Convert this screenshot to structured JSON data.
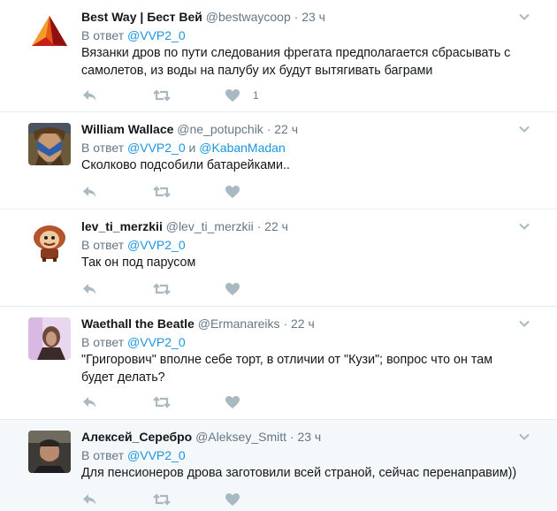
{
  "tweets": [
    {
      "name": "Best Way | Бест Вей",
      "handle": "@bestwaycoop",
      "dot": "·",
      "time": "23 ч",
      "reply_prefix": "В ответ",
      "mention1": "@VVP2_0",
      "text": "Вязанки дров по пути следования фрегата предполагается сбрасывать с самолетов, из воды на палубу их будут вытягивать баграми",
      "like_count": "1"
    },
    {
      "name": "William Wallace",
      "handle": "@ne_potupchik",
      "dot": "·",
      "time": "22 ч",
      "reply_prefix": "В ответ",
      "mention1": "@VVP2_0",
      "conj": "и",
      "mention2": "@KabanMadan",
      "text": "Сколково подсобили батарейками.."
    },
    {
      "name": "lev_ti_merzkii",
      "handle": "@lev_ti_merzkii",
      "dot": "·",
      "time": "22 ч",
      "reply_prefix": "В ответ",
      "mention1": "@VVP2_0",
      "text": "Так он под парусом"
    },
    {
      "name": "Waethall the Beatle",
      "handle": "@Ermanareiks",
      "dot": "·",
      "time": "22 ч",
      "reply_prefix": "В ответ",
      "mention1": "@VVP2_0",
      "text": "\"Григорович\" вполне себе торт, в отличии от \"Кузи\"; вопрос что он там будет делать?"
    },
    {
      "name": "Алексей_Серебро",
      "handle": "@Aleksey_Smitt",
      "dot": "·",
      "time": "23 ч",
      "reply_prefix": "В ответ",
      "mention1": "@VVP2_0",
      "text": "Для пенсионеров дрова заготовили всей страной, сейчас перенаправим))"
    }
  ],
  "icons": {
    "reply": "reply-icon",
    "retweet": "retweet-icon",
    "like": "heart-icon",
    "more": "chevron-down-icon"
  },
  "colors": {
    "name": "#14171a",
    "secondary": "#657786",
    "link": "#1b95e0",
    "action_icon": "#aab8c2",
    "divider": "#e6ecf0",
    "highlight_bg": "#f5f8fa"
  }
}
